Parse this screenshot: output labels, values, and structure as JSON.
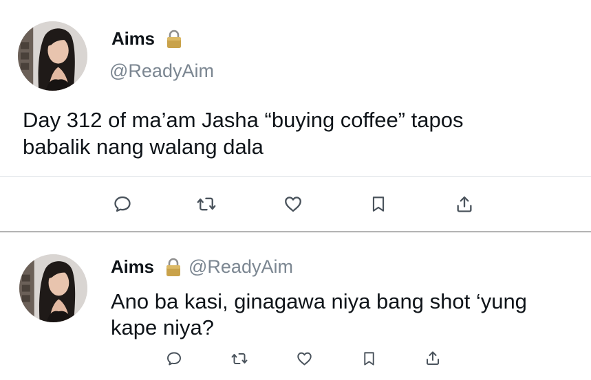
{
  "main_tweet": {
    "author_name": "Aims",
    "handle": "@ReadyAim",
    "avatar_icon": "profile-photo-icon",
    "verified_icon": "lock-icon",
    "text_line1": "Day 312 of ma’am Jasha “buying coffee” tapos",
    "text_line2": "babalik nang walang dala",
    "actions": [
      "reply-icon",
      "retweet-icon",
      "like-icon",
      "bookmark-icon",
      "share-icon"
    ]
  },
  "reply_tweet": {
    "author_name": "Aims",
    "handle": "@ReadyAim",
    "avatar_icon": "profile-photo-icon",
    "verified_icon": "lock-icon",
    "text_line1": "Ano ba kasi, ginagawa niya bang shot ‘yung",
    "text_line2": "kape niya?",
    "actions": [
      "reply-icon",
      "retweet-icon",
      "like-icon",
      "bookmark-icon",
      "share-icon"
    ]
  },
  "colors": {
    "text": "#0f1419",
    "secondary": "#7b8691",
    "icon": "#4a535c",
    "light_divider": "#e1e4e8",
    "dark_divider": "#3a3a3a",
    "lock": "#c9a24a"
  }
}
